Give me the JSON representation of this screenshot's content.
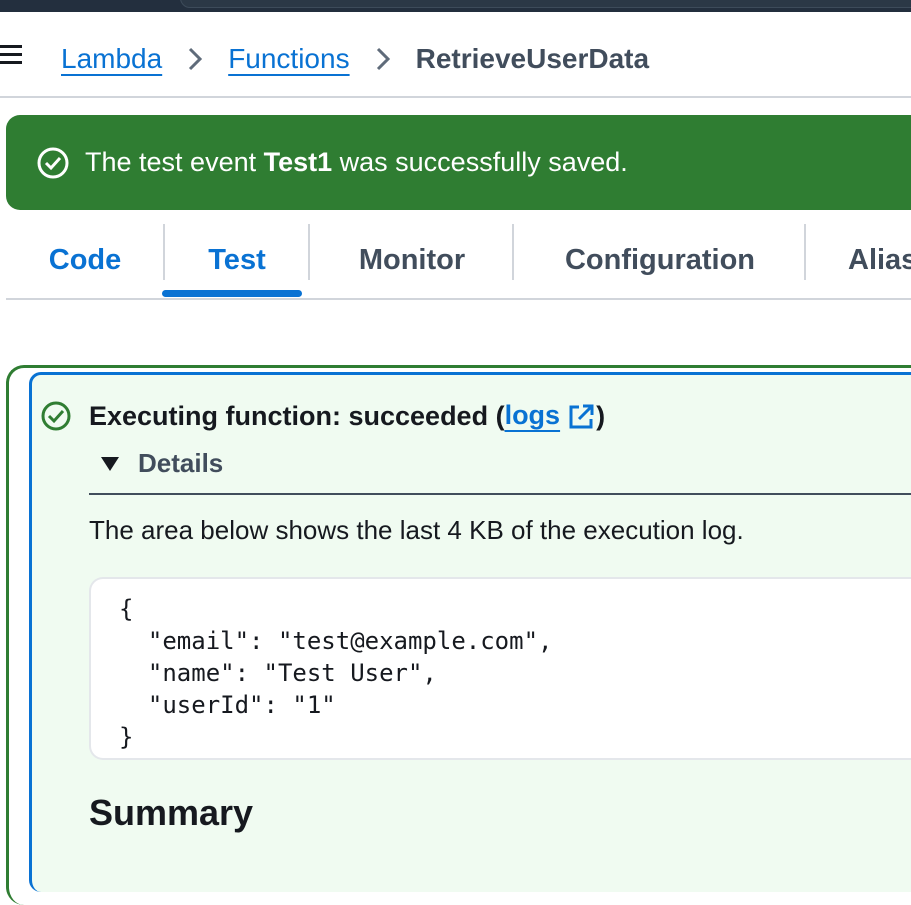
{
  "breadcrumb": {
    "items": [
      {
        "label": "Lambda"
      },
      {
        "label": "Functions"
      }
    ],
    "current": "RetrieveUserData"
  },
  "flash": {
    "prefix": "The test event ",
    "event_name": "Test1",
    "suffix": " was successfully saved.",
    "color": "#2f7d32"
  },
  "tabs": [
    {
      "label": "Code"
    },
    {
      "label": "Test",
      "selected": true
    },
    {
      "label": "Monitor"
    },
    {
      "label": "Configuration"
    },
    {
      "label": "Alias"
    }
  ],
  "result": {
    "status_prefix": "Executing function: succeeded (",
    "logs_label": "logs",
    "status_suffix": ")",
    "details_label": "Details",
    "description": "The area below shows the last 4 KB of the execution log.",
    "output": "{\n  \"email\": \"test@example.com\",\n  \"name\": \"Test User\",\n  \"userId\": \"1\"\n}",
    "summary_heading": "Summary"
  },
  "colors": {
    "link_blue": "#0972d3",
    "success_green": "#2f7d32",
    "result_bg": "#f0fbf1"
  },
  "icons": {
    "menu": "menu-icon",
    "separator": "chevron-right-icon",
    "success": "check-circle-icon",
    "external": "external-link-icon",
    "caret": "caret-down-icon"
  }
}
